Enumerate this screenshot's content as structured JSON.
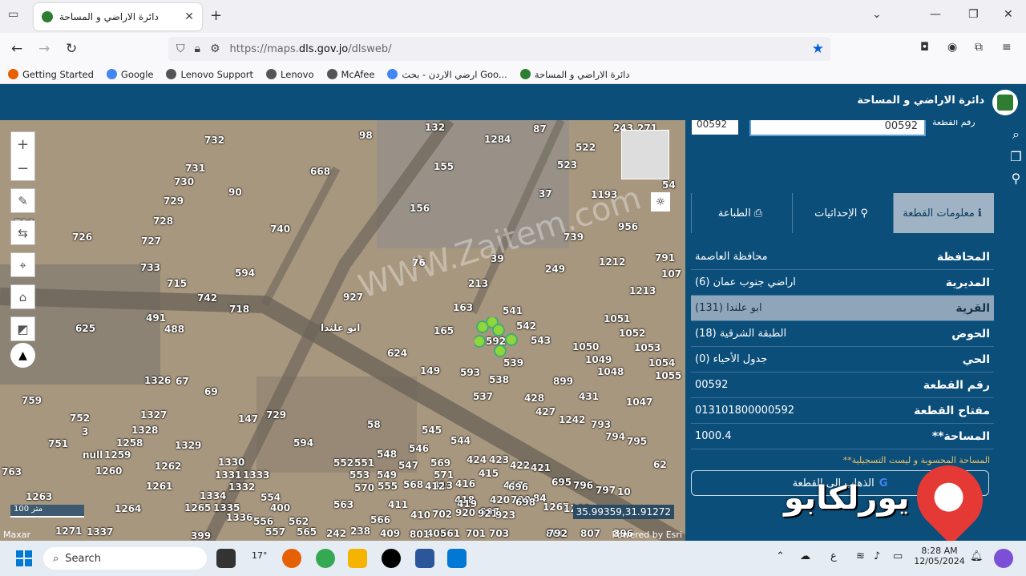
{
  "browser": {
    "tab_title": "دائرة الاراضي و المساحة",
    "url_prefix": "https://maps.",
    "url_domain": "dls.gov.jo",
    "url_path": "/dlsweb/",
    "bookmarks": [
      {
        "label": "Getting Started",
        "color": "#e66000"
      },
      {
        "label": "Google",
        "color": "#4285f4"
      },
      {
        "label": "Lenovo Support",
        "color": "#555555"
      },
      {
        "label": "Lenovo",
        "color": "#555555"
      },
      {
        "label": "McAfee",
        "color": "#555555"
      },
      {
        "label": "ارضي الاردن - بحث Goo...",
        "color": "#4285f4"
      },
      {
        "label": "دائرة الاراضي و المساحة",
        "color": "#2e7d32"
      }
    ]
  },
  "app": {
    "title": "دائرة الاراضي و المساحة",
    "accent": "#0b4e7a"
  },
  "map": {
    "parcels": [
      {
        "n": "98"
      },
      {
        "n": "132"
      },
      {
        "n": "87"
      },
      {
        "n": "243"
      },
      {
        "n": "271"
      },
      {
        "n": "732"
      },
      {
        "n": "1284"
      },
      {
        "n": "522"
      },
      {
        "n": "668"
      },
      {
        "n": "155"
      },
      {
        "n": "523"
      },
      {
        "n": "731"
      },
      {
        "n": "730"
      },
      {
        "n": "90"
      },
      {
        "n": "37"
      },
      {
        "n": "1193"
      },
      {
        "n": "729"
      },
      {
        "n": "156"
      },
      {
        "n": "728"
      },
      {
        "n": "740"
      },
      {
        "n": "956"
      },
      {
        "n": "710"
      },
      {
        "n": "726"
      },
      {
        "n": "727"
      },
      {
        "n": "739"
      },
      {
        "n": "733"
      },
      {
        "n": "76"
      },
      {
        "n": "39"
      },
      {
        "n": "249"
      },
      {
        "n": "1212"
      },
      {
        "n": "594"
      },
      {
        "n": "715"
      },
      {
        "n": "213"
      },
      {
        "n": "742"
      },
      {
        "n": "927"
      },
      {
        "n": "1213"
      },
      {
        "n": "718"
      },
      {
        "n": "163"
      },
      {
        "n": "541"
      },
      {
        "n": "491"
      },
      {
        "n": "625"
      },
      {
        "n": "488"
      },
      {
        "n": "ابو علندا"
      },
      {
        "n": "165"
      },
      {
        "n": "592"
      },
      {
        "n": "542"
      },
      {
        "n": "1051"
      },
      {
        "n": "543"
      },
      {
        "n": "1052"
      },
      {
        "n": "624"
      },
      {
        "n": "1050"
      },
      {
        "n": "1053"
      },
      {
        "n": "539"
      },
      {
        "n": "1049"
      },
      {
        "n": "1054"
      },
      {
        "n": "149"
      },
      {
        "n": "593"
      },
      {
        "n": "1048"
      },
      {
        "n": "538"
      },
      {
        "n": "899"
      },
      {
        "n": "1055"
      },
      {
        "n": "1326"
      },
      {
        "n": "67"
      },
      {
        "n": "69"
      },
      {
        "n": "537"
      },
      {
        "n": "428"
      },
      {
        "n": "431"
      },
      {
        "n": "1047"
      },
      {
        "n": "759"
      },
      {
        "n": "427"
      },
      {
        "n": "1327"
      },
      {
        "n": "147"
      },
      {
        "n": "729"
      },
      {
        "n": "752"
      },
      {
        "n": "58"
      },
      {
        "n": "1242"
      },
      {
        "n": "793"
      },
      {
        "n": "1328"
      },
      {
        "n": "545"
      },
      {
        "n": "3"
      },
      {
        "n": "544"
      },
      {
        "n": "794"
      },
      {
        "n": "795"
      },
      {
        "n": "751"
      },
      {
        "n": "1258"
      },
      {
        "n": "594"
      },
      {
        "n": "1329"
      },
      {
        "n": "546"
      },
      {
        "n": "null"
      },
      {
        "n": "1259"
      },
      {
        "n": "548"
      },
      {
        "n": "424"
      },
      {
        "n": "423"
      },
      {
        "n": "62"
      },
      {
        "n": "1260"
      },
      {
        "n": "1262"
      },
      {
        "n": "1330"
      },
      {
        "n": "552"
      },
      {
        "n": "551"
      },
      {
        "n": "547"
      },
      {
        "n": "569"
      },
      {
        "n": "422"
      },
      {
        "n": "421"
      },
      {
        "n": "763"
      },
      {
        "n": "1331"
      },
      {
        "n": "1333"
      },
      {
        "n": "553"
      },
      {
        "n": "549"
      },
      {
        "n": "571"
      },
      {
        "n": "415"
      },
      {
        "n": "695"
      },
      {
        "n": "1261"
      },
      {
        "n": "1332"
      },
      {
        "n": "555"
      },
      {
        "n": "568"
      },
      {
        "n": "413"
      },
      {
        "n": "416"
      },
      {
        "n": "417"
      },
      {
        "n": "696"
      },
      {
        "n": "796"
      },
      {
        "n": "797"
      },
      {
        "n": "10"
      },
      {
        "n": "1263"
      },
      {
        "n": "1334"
      },
      {
        "n": "554"
      },
      {
        "n": "570"
      },
      {
        "n": "412"
      },
      {
        "n": "418"
      },
      {
        "n": "420"
      },
      {
        "n": "700"
      },
      {
        "n": "84"
      },
      {
        "n": "1264"
      },
      {
        "n": "1265"
      },
      {
        "n": "1335"
      },
      {
        "n": "400"
      },
      {
        "n": "563"
      },
      {
        "n": "411"
      },
      {
        "n": "419"
      },
      {
        "n": "698"
      },
      {
        "n": "697"
      },
      {
        "n": "1267"
      },
      {
        "n": "1268"
      },
      {
        "n": "1336"
      },
      {
        "n": "556"
      },
      {
        "n": "562"
      },
      {
        "n": "566"
      },
      {
        "n": "410"
      },
      {
        "n": "702"
      },
      {
        "n": "920"
      },
      {
        "n": "921"
      },
      {
        "n": "923"
      },
      {
        "n": "1271"
      },
      {
        "n": "1337"
      },
      {
        "n": "399"
      },
      {
        "n": "557"
      },
      {
        "n": "565"
      },
      {
        "n": "242"
      },
      {
        "n": "409"
      },
      {
        "n": "408"
      },
      {
        "n": "701"
      },
      {
        "n": "703"
      },
      {
        "n": "800"
      },
      {
        "n": "807"
      },
      {
        "n": "396"
      },
      {
        "n": "238"
      },
      {
        "n": "561"
      },
      {
        "n": "801"
      },
      {
        "n": "792"
      },
      {
        "n": "791"
      },
      {
        "n": "107"
      },
      {
        "n": "54"
      }
    ],
    "scale_label": "100 متر",
    "coordinates": "35.99359,31.91272",
    "attribution_left": "Maxar",
    "attribution_right": "Powered by Esri",
    "watermark": "WWW.Zaitem.com"
  },
  "panel": {
    "parcel_input_value": "00592",
    "small_input_value": "00592",
    "parcel_input_label": "رقم القطعة",
    "tabs": [
      {
        "label": "معلومات القطعة",
        "icon": "info-icon",
        "glyph": "ℹ"
      },
      {
        "label": "الإحداثيات",
        "icon": "pin-icon",
        "glyph": "⚲"
      },
      {
        "label": "الطباعة",
        "icon": "printer-icon",
        "glyph": "⎙"
      }
    ],
    "rows": [
      {
        "label": "المحافظة",
        "value": "محافظة العاصمة"
      },
      {
        "label": "المديرية",
        "value": "اراضي جنوب عمان (6)"
      },
      {
        "label": "القرية",
        "value": "ابو علندا (131)"
      },
      {
        "label": "الحوض",
        "value": "الطبقة الشرقية (18)"
      },
      {
        "label": "الحي",
        "value": "جدول الأحياء (0)"
      },
      {
        "label": "رقم القطعة",
        "value": "00592"
      },
      {
        "label": "مفتاح القطعة",
        "value": "013101800000592"
      },
      {
        "label": "**المساحة",
        "value": "1000.4"
      }
    ],
    "note": "**المساحة المحسوبة و ليست التسجيلية",
    "go_button": "الذهاب الى القطعة",
    "brand_watermark": "يورلكابو"
  },
  "taskbar": {
    "search_placeholder": "Search",
    "weather": "17°",
    "time": "8:28 AM",
    "date": "12/05/2024",
    "lang": "ع"
  }
}
